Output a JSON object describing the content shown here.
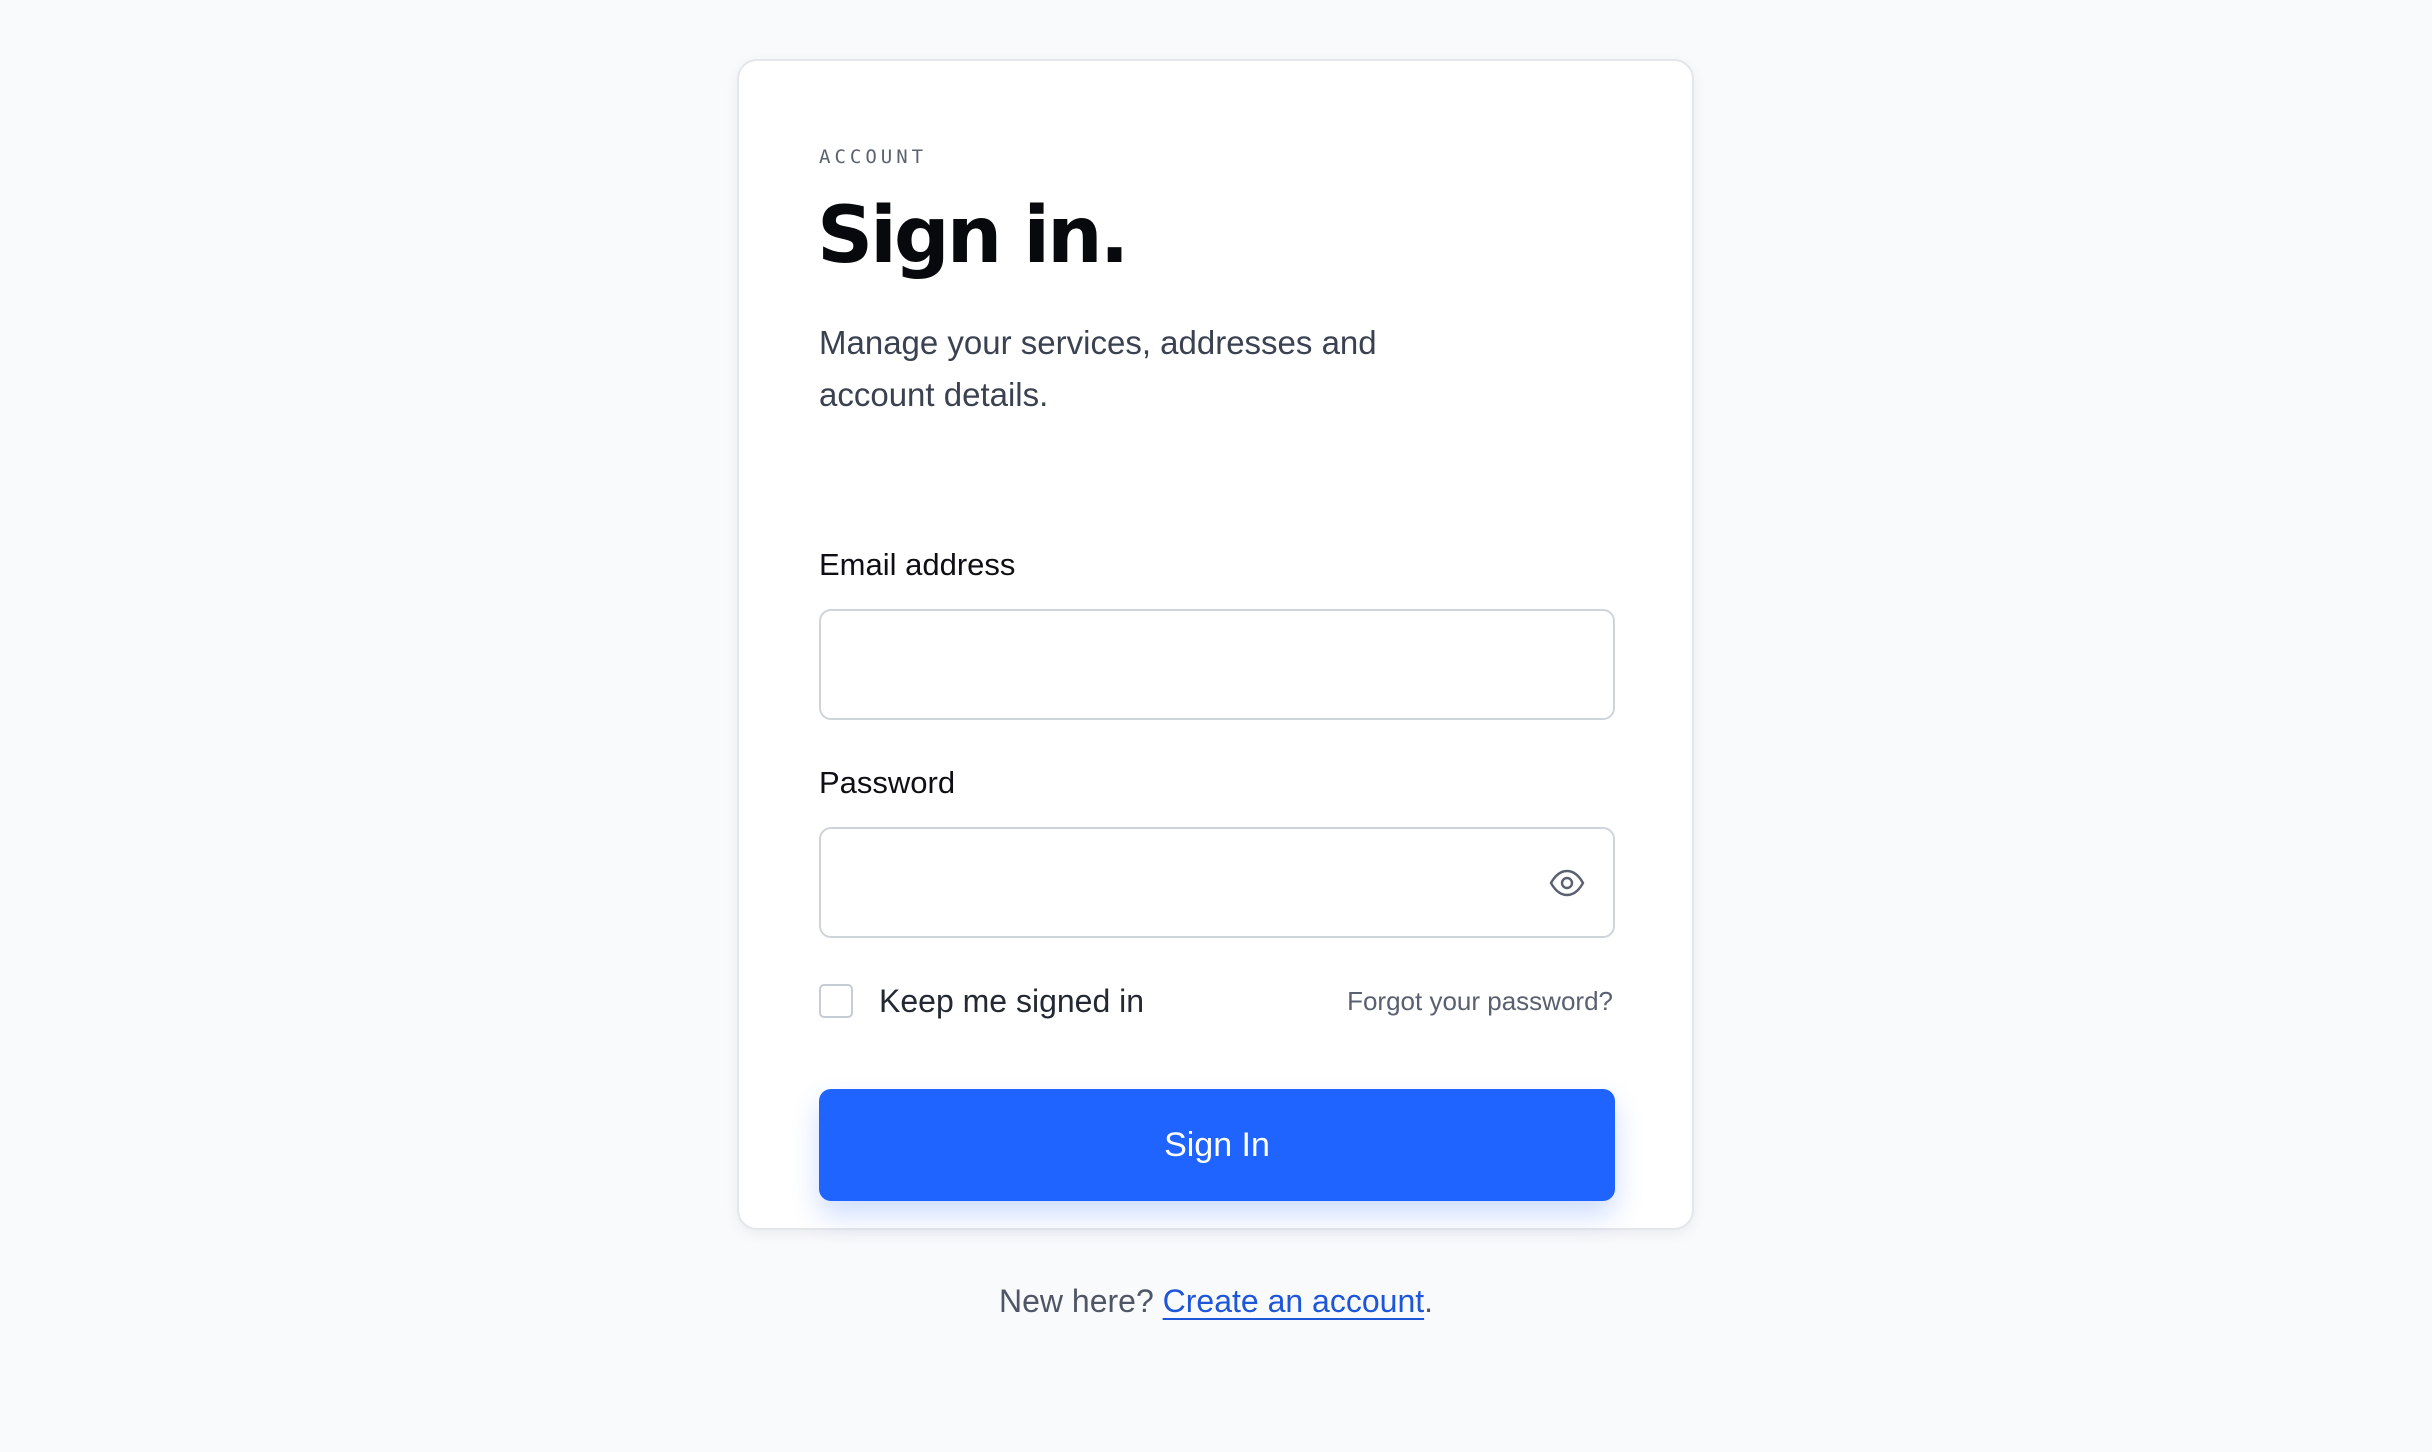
{
  "card": {
    "eyebrow": "ACCOUNT",
    "title": "Sign in.",
    "subtitle": "Manage your services, addresses and account details."
  },
  "form": {
    "email": {
      "label": "Email address",
      "value": "",
      "placeholder": ""
    },
    "password": {
      "label": "Password",
      "value": "",
      "placeholder": "",
      "toggle_icon": "eye-icon"
    },
    "remember": {
      "label": "Keep me signed in",
      "checked": false
    },
    "forgot_link": "Forgot your password?",
    "submit_label": "Sign In"
  },
  "footer": {
    "prompt": "New here?",
    "link_label": "Create an account",
    "suffix": "."
  },
  "colors": {
    "page_background": "#f9fafc",
    "accent": "#1f64ff",
    "link": "#1d56d8"
  }
}
